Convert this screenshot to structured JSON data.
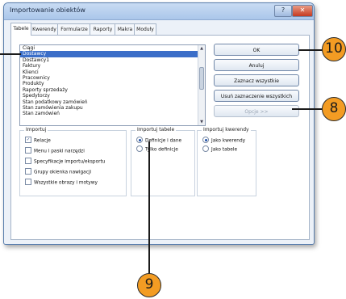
{
  "window": {
    "title": "Importowanie obiektów",
    "help_glyph": "?",
    "close_glyph": "✕"
  },
  "tabs": [
    {
      "label": "Tabele"
    },
    {
      "label": "Kwerendy"
    },
    {
      "label": "Formularze"
    },
    {
      "label": "Raporty"
    },
    {
      "label": "Makra"
    },
    {
      "label": "Moduły"
    }
  ],
  "list": {
    "items": [
      {
        "label": "Ciągi"
      },
      {
        "label": "Dostawcy"
      },
      {
        "label": "Dostawcy1"
      },
      {
        "label": "Faktury"
      },
      {
        "label": "Klienci"
      },
      {
        "label": "Pracownicy"
      },
      {
        "label": "Produkty"
      },
      {
        "label": "Raporty sprzedaży"
      },
      {
        "label": "Spedytorzy"
      },
      {
        "label": "Stan podatkowy zamówień"
      },
      {
        "label": "Stan zamówienia zakupu"
      },
      {
        "label": "Stan zamówień"
      }
    ],
    "selected_index": 1,
    "scroll_up_glyph": "▲",
    "scroll_down_glyph": "▼"
  },
  "buttons": {
    "ok": "OK",
    "cancel": "Anuluj",
    "select_all": "Zaznacz wszystkie",
    "deselect_all": "Usuń zaznaczenie wszystkich",
    "options": "Opcje >>"
  },
  "import_group": {
    "title": "Importuj",
    "checkmark_glyph": "✓",
    "options": [
      {
        "label": "Relacje",
        "checked": true
      },
      {
        "label": "Menu i paski narzędzi",
        "checked": false
      },
      {
        "label": "Specyfikacje importu/eksportu",
        "checked": false
      },
      {
        "label": "Grupy okienka nawigacji",
        "checked": false
      },
      {
        "label": "Wszystkie obrazy i motywy",
        "checked": false
      }
    ]
  },
  "import_tables_group": {
    "title": "Importuj tabele",
    "options": [
      {
        "label": "Definicje i dane",
        "selected": true
      },
      {
        "label": "Tylko definicje",
        "selected": false
      }
    ]
  },
  "import_queries_group": {
    "title": "Importuj kwerendy",
    "options": [
      {
        "label": "Jako kwerendy",
        "selected": true
      },
      {
        "label": "Jako tabele",
        "selected": false
      }
    ]
  },
  "callouts": {
    "ok": "10",
    "options": "8",
    "groups": "9"
  },
  "colors": {
    "callout": "#f39c23",
    "selection": "#3b6ec8",
    "frame": "#5a7fae"
  }
}
